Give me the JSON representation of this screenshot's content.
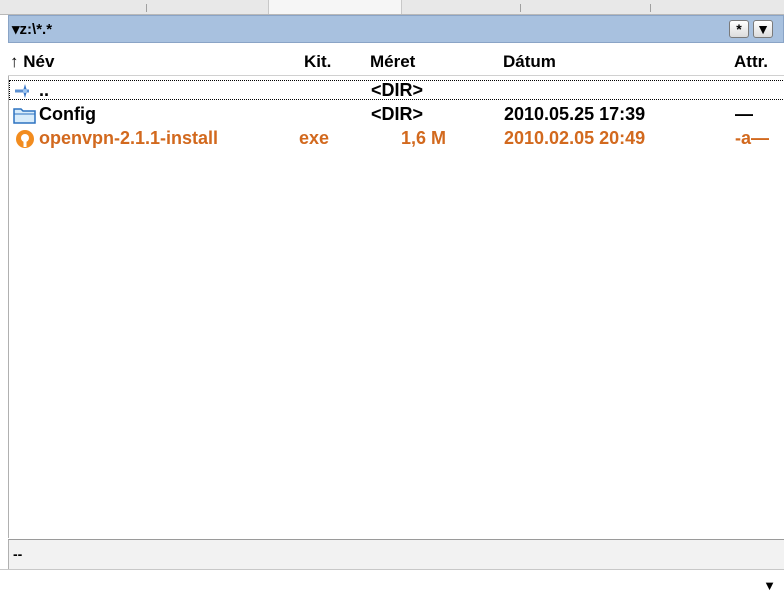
{
  "path": {
    "text": "▾z:\\*.*",
    "star_button": "*",
    "dropdown_button": "▼"
  },
  "columns": {
    "name": "↑ Név",
    "ext": "Kit.",
    "size": "Méret",
    "date": "Dátum",
    "attr": "Attr."
  },
  "rows": [
    {
      "icon": "up-dir-icon",
      "name": "..",
      "ext": "",
      "size": "<DIR>",
      "date": "",
      "attr": ""
    },
    {
      "icon": "folder-icon",
      "name": "Config",
      "ext": "",
      "size": "<DIR>",
      "date": "2010.05.25 17:39",
      "attr": "—"
    },
    {
      "icon": "openvpn-icon",
      "name": "openvpn-2.1.1-install",
      "ext": "exe",
      "size": "1,6 M",
      "date": "2010.02.05 20:49",
      "attr": "-a—"
    }
  ],
  "status": "--",
  "cmdline": {
    "dropdown": "▼"
  },
  "colors": {
    "path_bar": "#a8c1df",
    "exe_text": "#d2691e"
  }
}
